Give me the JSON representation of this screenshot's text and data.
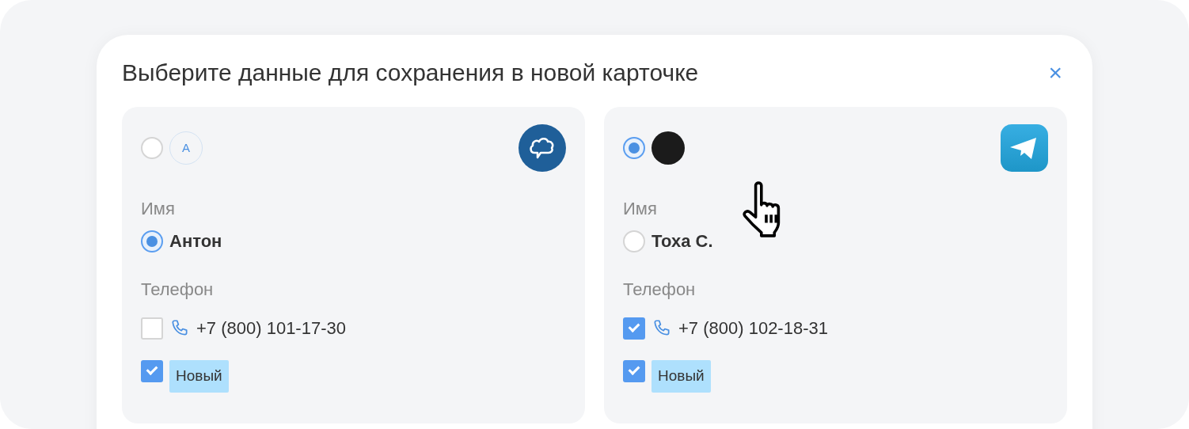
{
  "dialog": {
    "title": "Выберите данные для сохранения в новой карточке",
    "close": "×"
  },
  "cards": [
    {
      "selected": false,
      "avatar": {
        "kind": "initial",
        "text": "A"
      },
      "source": {
        "kind": "cloud-chat"
      },
      "name_label": "Имя",
      "name": {
        "text": "Антон",
        "selected": true
      },
      "phone_label": "Телефон",
      "phone": {
        "text": "+7 (800) 101-17-30",
        "checked": false
      },
      "tag": {
        "text": "Новый",
        "checked": true
      }
    },
    {
      "selected": true,
      "avatar": {
        "kind": "photo"
      },
      "source": {
        "kind": "telegram"
      },
      "name_label": "Имя",
      "name": {
        "text": "Тоха С.",
        "selected": false
      },
      "phone_label": "Телефон",
      "phone": {
        "text": "+7 (800) 102-18-31",
        "checked": true
      },
      "tag": {
        "text": "Новый",
        "checked": true
      }
    }
  ]
}
